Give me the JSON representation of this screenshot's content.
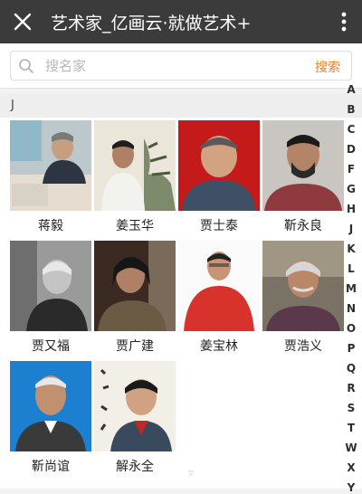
{
  "app": {
    "title": "艺术家_亿画云·就做艺术+",
    "close_icon": "close-icon",
    "more_icon": "more-vertical-icon"
  },
  "search": {
    "placeholder": "搜名家",
    "value": "",
    "button_label": "搜索",
    "icon": "search-icon"
  },
  "section": {
    "letter": "J"
  },
  "artists": [
    {
      "name": "蒋毅"
    },
    {
      "name": "姜玉华"
    },
    {
      "name": "贾士泰"
    },
    {
      "name": "靳永良"
    },
    {
      "name": "贾又福"
    },
    {
      "name": "贾广建"
    },
    {
      "name": "姜宝林"
    },
    {
      "name": "贾浩义"
    },
    {
      "name": "靳尚谊"
    },
    {
      "name": "解永全"
    }
  ],
  "index_letters": [
    "A",
    "B",
    "C",
    "D",
    "F",
    "G",
    "H",
    "J",
    "K",
    "L",
    "M",
    "N",
    "O",
    "P",
    "Q",
    "R",
    "S",
    "T",
    "W",
    "X",
    "Y"
  ],
  "colors": {
    "topbar": "#3b3b3b",
    "accent": "#ee7f28"
  }
}
